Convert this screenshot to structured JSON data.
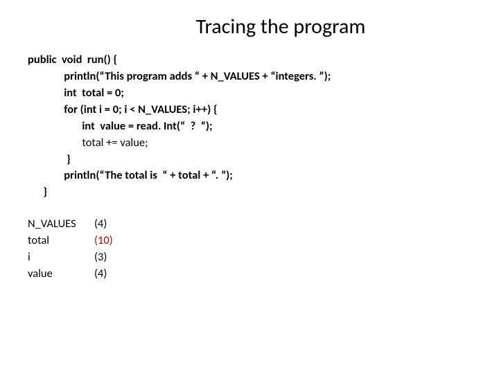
{
  "title": "Tracing the program",
  "code": {
    "l1": "public  void  run() {",
    "l2": "              println(“This program adds “ + N_VALUES + “integers. ”);",
    "l3": "              int  total = 0;",
    "l4": "              for (int i = 0; i < N_VALUES; i++) {",
    "l5": "                     int  value = read. Int(“  ?  “);",
    "l6": "                     total += value;",
    "l7": "               }",
    "l8": "              println(“The total is  “ + total + “. ”);",
    "l9": "      }"
  },
  "trace": {
    "r1": {
      "label": "N_VALUES",
      "value": "(4)"
    },
    "r2": {
      "label": "total",
      "value": "(10)"
    },
    "r3": {
      "label": "i",
      "value": "(3)"
    },
    "r4": {
      "label": "value",
      "value": "(4)"
    }
  }
}
